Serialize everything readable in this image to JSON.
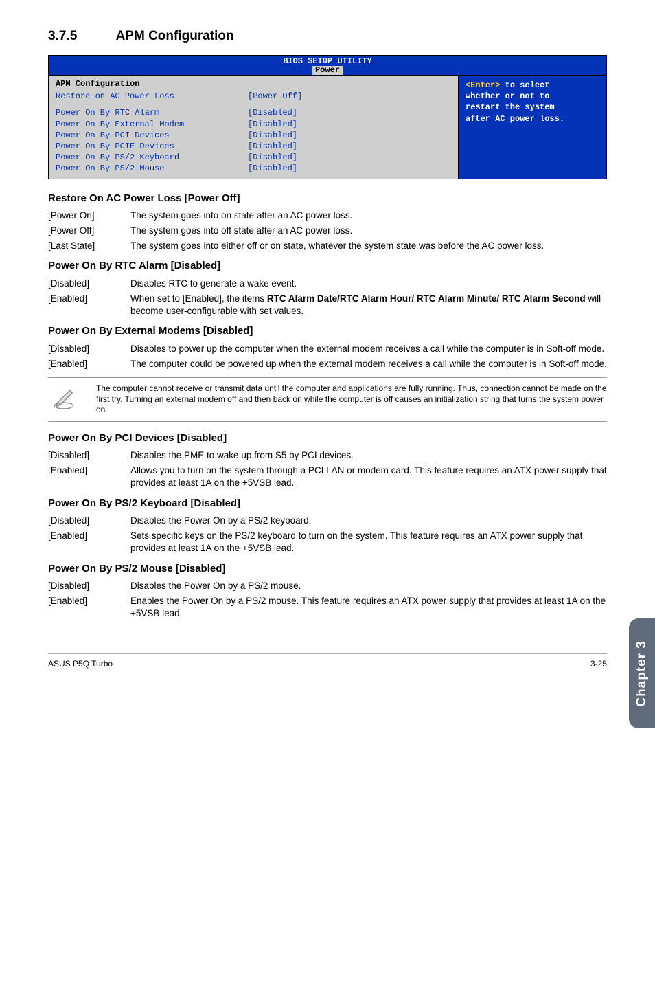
{
  "section": {
    "num": "3.7.5",
    "title": "APM Configuration"
  },
  "bios": {
    "header": "BIOS SETUP UTILITY",
    "tab": "Power",
    "panel_title": "APM Configuration",
    "rows": [
      {
        "label": "Restore on AC Power Loss",
        "value": "[Power Off]"
      },
      {
        "label": "Power On By RTC Alarm",
        "value": "[Disabled]"
      },
      {
        "label": "Power On By External Modem",
        "value": "[Disabled]"
      },
      {
        "label": "Power On By PCI Devices",
        "value": "[Disabled]"
      },
      {
        "label": "Power On By PCIE Devices",
        "value": "[Disabled]"
      },
      {
        "label": "Power On By PS/2 Keyboard",
        "value": "[Disabled]"
      },
      {
        "label": "Power On By PS/2 Mouse",
        "value": "[Disabled]"
      }
    ],
    "help": {
      "l1a": "<Enter>",
      "l1b": " to select",
      "l2": "whether or not to",
      "l3": "restart the system",
      "l4": "after AC power loss."
    }
  },
  "items": [
    {
      "title": "Restore On AC Power Loss [Power Off]",
      "opts": [
        {
          "key": "[Power On]",
          "val": "The system goes into on state after an AC power loss."
        },
        {
          "key": "[Power Off]",
          "val": "The system goes into off state after an AC power loss."
        },
        {
          "key": "[Last State]",
          "val": "The system goes into either off or on state, whatever the system state was before the AC power loss."
        }
      ]
    },
    {
      "title": "Power On By RTC Alarm [Disabled]",
      "opts": [
        {
          "key": "[Disabled]",
          "val": "Disables RTC to generate a wake event."
        },
        {
          "key": "[Enabled]",
          "val": "When set to [Enabled], the items <b>RTC Alarm Date/RTC Alarm Hour/ RTC Alarm Minute/ RTC Alarm Second</b> will become user-configurable with set values."
        }
      ]
    },
    {
      "title": "Power On By External Modems [Disabled]",
      "opts": [
        {
          "key": "[Disabled]",
          "val": "Disables to power up the computer when the external modem receives a call while the computer is in Soft-off mode."
        },
        {
          "key": "[Enabled]",
          "val": "The computer could be powered up when the external modem receives a call while the computer is in Soft-off mode."
        }
      ]
    }
  ],
  "note": "The computer cannot receive or transmit data until the computer and applications are fully running. Thus, connection cannot be made on the first try. Turning an external modem off and then back on while the computer is off causes an initialization string that turns the system power on.",
  "items2": [
    {
      "title": "Power On By PCI Devices [Disabled]",
      "opts": [
        {
          "key": "[Disabled]",
          "val": "Disables the PME to wake up from S5 by PCI devices."
        },
        {
          "key": "[Enabled]",
          "val": "Allows you to turn on the system through a PCI LAN or modem card. This feature requires an ATX power supply that provides at least 1A on the +5VSB lead."
        }
      ]
    },
    {
      "title": "Power On By PS/2 Keyboard [Disabled]",
      "opts": [
        {
          "key": "[Disabled]",
          "val": "Disables the Power On by a PS/2 keyboard."
        },
        {
          "key": "[Enabled]",
          "val": "Sets specific keys on the PS/2 keyboard to turn on the system. This feature requires an ATX power supply that provides at least 1A on the +5VSB lead."
        }
      ]
    },
    {
      "title": "Power On By PS/2 Mouse [Disabled]",
      "opts": [
        {
          "key": "[Disabled]",
          "val": "Disables the Power On by a PS/2 mouse."
        },
        {
          "key": "[Enabled]",
          "val": "Enables the Power On by a PS/2 mouse. This feature requires an ATX power supply that provides at least 1A on the +5VSB lead."
        }
      ]
    }
  ],
  "sidebar": "Chapter 3",
  "footer": {
    "left": "ASUS P5Q Turbo",
    "right": "3-25"
  }
}
